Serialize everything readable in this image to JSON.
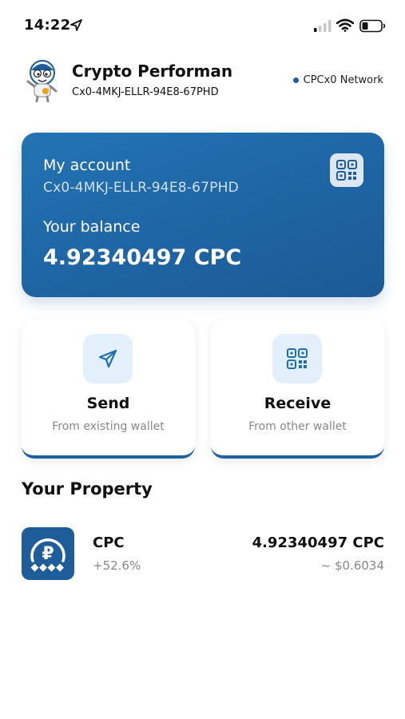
{
  "status_bar": {
    "time": "14:22",
    "icons": [
      "location-arrow-icon",
      "cellular-signal-icon",
      "wifi-icon",
      "battery-icon"
    ]
  },
  "header": {
    "wallet_name": "Crypto Performan",
    "wallet_address": "Cx0-4MKJ-ELLR-94E8-67PHD",
    "network": "CPCx0 Network",
    "avatar_icon": "mascot-avatar-icon"
  },
  "account_card": {
    "label": "My account",
    "address": "Cx0-4MKJ-ELLR-94E8-67PHD",
    "balance_label": "Your balance",
    "balance": "4.92340497 CPC",
    "qr_icon": "qr-code-icon"
  },
  "actions": {
    "send": {
      "title": "Send",
      "subtitle": "From existing wallet",
      "icon": "send-arrow-icon"
    },
    "receive": {
      "title": "Receive",
      "subtitle": "From other wallet",
      "icon": "qr-code-icon"
    }
  },
  "property": {
    "title": "Your Property",
    "items": [
      {
        "name": "CPC",
        "change": "+52.6%",
        "amount": "4.92340497 CPC",
        "fiat": "~ $0.6034",
        "icon": "cpc-coin-icon"
      }
    ]
  },
  "colors": {
    "accent": "#1f67a7",
    "card_gradient_start": "#2374b3",
    "card_gradient_end": "#1c5a95",
    "icon_bg": "#e3f0fb",
    "muted_text": "#888888"
  }
}
